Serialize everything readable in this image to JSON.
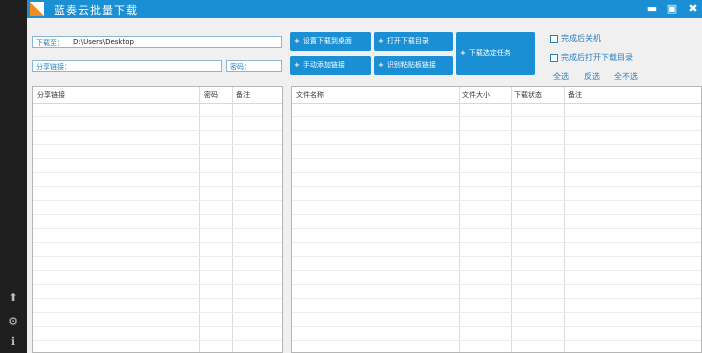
{
  "app": {
    "title": "蓝奏云批量下载"
  },
  "window_controls": {
    "minimize": "▬",
    "maximize": "▣",
    "close": "✖"
  },
  "sidebar": {
    "icons": [
      {
        "name": "up-arrow-icon",
        "glyph": "⬆"
      },
      {
        "name": "gear-icon",
        "glyph": "⚙"
      },
      {
        "name": "info-icon",
        "glyph": "ℹ"
      }
    ]
  },
  "form": {
    "download_to_label": "下载至：",
    "download_to_value": "D:\\Users\\Desktop",
    "share_link_label": "分享链接：",
    "share_link_value": "",
    "password_label": "密码：",
    "password_value": ""
  },
  "buttons": {
    "set_download_desktop": "设置下载到桌面",
    "open_download_dir": "打开下载目录",
    "manual_add_link": "手动添加链接",
    "recognize_clipboard": "识别粘贴板链接",
    "download_selected": "下载选定任务",
    "plus": "+"
  },
  "options": {
    "shutdown_after": "完成后关机",
    "open_dir_after": "完成后打开下载目录",
    "select_all": "全选",
    "invert": "反选",
    "select_none": "全不选"
  },
  "left_table": {
    "columns": [
      "分享链接",
      "密码",
      "备注"
    ],
    "rows": []
  },
  "right_table": {
    "columns": [
      "文件名称",
      "文件大小",
      "下载状态",
      "备注"
    ],
    "rows": []
  }
}
